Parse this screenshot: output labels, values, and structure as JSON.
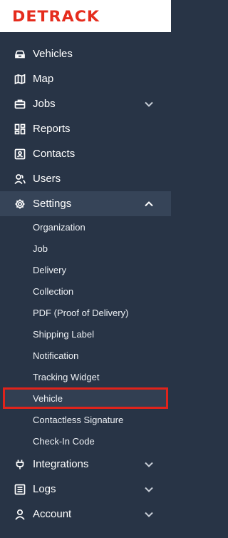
{
  "brand": {
    "logo_text": "DETRACK"
  },
  "nav": {
    "vehicles": "Vehicles",
    "map": "Map",
    "jobs": "Jobs",
    "reports": "Reports",
    "contacts": "Contacts",
    "users": "Users",
    "settings": "Settings",
    "integrations": "Integrations",
    "logs": "Logs",
    "account": "Account"
  },
  "settings_submenu": {
    "organization": "Organization",
    "job": "Job",
    "delivery": "Delivery",
    "collection": "Collection",
    "pdf": "PDF (Proof of Delivery)",
    "shipping_label": "Shipping Label",
    "notification": "Notification",
    "tracking_widget": "Tracking Widget",
    "vehicle": "Vehicle",
    "contactless_signature": "Contactless Signature",
    "check_in_code": "Check-In Code"
  },
  "colors": {
    "sidebar_bg": "#283446",
    "active_bg": "#364458",
    "brand_red": "#e52c1d",
    "highlight_border": "#e0231b"
  },
  "icons": {
    "vehicles": "car-icon",
    "map": "map-icon",
    "jobs": "briefcase-icon",
    "reports": "dashboard-icon",
    "contacts": "contact-card-icon",
    "users": "users-icon",
    "settings": "gear-icon",
    "integrations": "plug-icon",
    "logs": "list-icon",
    "account": "user-icon"
  }
}
